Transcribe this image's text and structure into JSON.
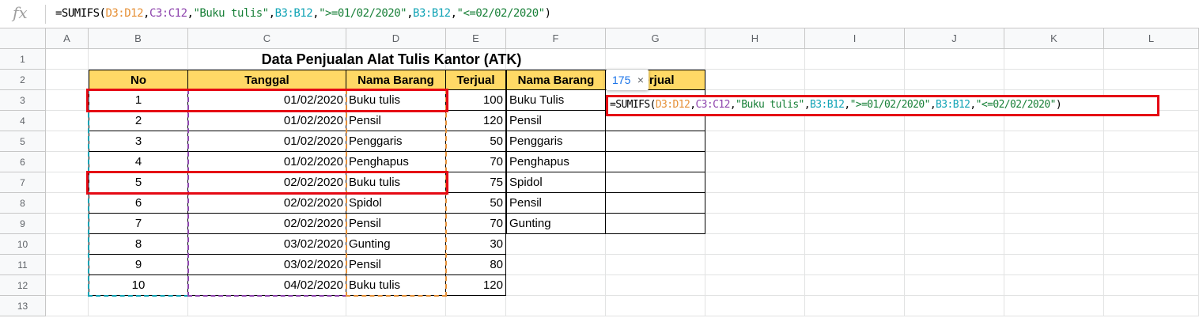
{
  "formula_bar": {
    "fx_label": "fx",
    "formula": "=SUMIFS(D3:D12,C3:C12,\"Buku tulis\",B3:B12,\">=01/02/2020\",B3:B12,\"<=02/02/2020\")",
    "parts": [
      "=SUMIFS(",
      "D3:D12",
      ",",
      "C3:C12",
      ",",
      "\"Buku tulis\"",
      ",",
      "B3:B12",
      ",",
      "\">=01/02/2020\"",
      ",",
      "B3:B12",
      ",",
      "\"<=02/02/2020\"",
      ")"
    ]
  },
  "columns": [
    "A",
    "B",
    "C",
    "D",
    "E",
    "F",
    "G",
    "H",
    "I",
    "J",
    "K",
    "L"
  ],
  "rows": [
    "1",
    "2",
    "3",
    "4",
    "5",
    "6",
    "7",
    "8",
    "9",
    "10",
    "11",
    "12",
    "13"
  ],
  "title": "Data Penjualan Alat Tulis Kantor (ATK)",
  "table1": {
    "headers": [
      "No",
      "Tanggal",
      "Nama Barang",
      "Terjual"
    ],
    "rows": [
      [
        "1",
        "01/02/2020",
        "Buku tulis",
        "100"
      ],
      [
        "2",
        "01/02/2020",
        "Pensil",
        "120"
      ],
      [
        "3",
        "01/02/2020",
        "Penggaris",
        "50"
      ],
      [
        "4",
        "01/02/2020",
        "Penghapus",
        "70"
      ],
      [
        "5",
        "02/02/2020",
        "Buku tulis",
        "75"
      ],
      [
        "6",
        "02/02/2020",
        "Spidol",
        "50"
      ],
      [
        "7",
        "02/02/2020",
        "Pensil",
        "70"
      ],
      [
        "8",
        "03/02/2020",
        "Gunting",
        "30"
      ],
      [
        "9",
        "03/02/2020",
        "Pensil",
        "80"
      ],
      [
        "10",
        "04/02/2020",
        "Buku tulis",
        "120"
      ]
    ]
  },
  "table2": {
    "headers": [
      "Nama Barang",
      "Terjual"
    ],
    "items": [
      "Buku Tulis",
      "Pensil",
      "Penggaris",
      "Penghapus",
      "Spidol",
      "Pensil",
      "Gunting"
    ]
  },
  "tooltip": {
    "value": "175",
    "close": "×"
  },
  "colors": {
    "header_fill": "#ffd966",
    "highlight_red": "#e50914",
    "range_orange": "#e69138",
    "range_purple": "#8e44ad",
    "range_cyan": "#12a4b6"
  }
}
